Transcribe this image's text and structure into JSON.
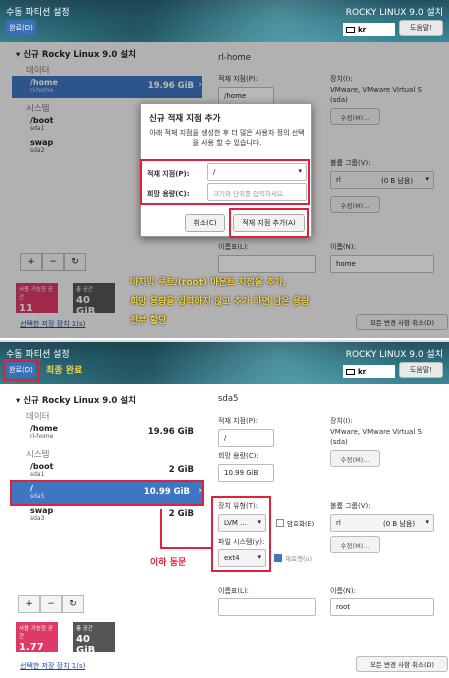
{
  "screen1": {
    "title": "수동 파티션 설정",
    "product": "ROCKY LINUX 9.0 설치",
    "done_label": "완료(D)",
    "keyboard": "kr",
    "help_label": "도움말!",
    "install_group": "신규 Rocky Linux 9.0 설치",
    "category_data": "데이터",
    "category_system": "시스템",
    "partitions": [
      {
        "name": "/home",
        "device": "rl-home",
        "size": "19.96 GiB"
      },
      {
        "name": "/boot",
        "device": "sda1",
        "size": ""
      },
      {
        "name": "swap",
        "device": "sda2",
        "size": ""
      }
    ],
    "selected_name": "rl-home",
    "mount_label": "적재 지점(P):",
    "mount_value": "/home",
    "device_label": "장치(I):",
    "device_value": "VMware, VMware Virtual S",
    "device_value2": "(sda)",
    "modify_label": "수정(M)...",
    "volume_group_label": "볼륨 그룹(V):",
    "volume_group_value": "rl",
    "volume_group_free": "(0 B 남음)",
    "label_label": "이름표(L):",
    "name_label": "이름(N):",
    "name_value": "home",
    "available_label": "사용 가능한 공간",
    "available_value": "11 GiB",
    "total_label": "총 공간",
    "total_value": "40 GiB",
    "storage_link": "선택한 저장 장치 1(s)",
    "reset_label": "모든 변경 사항 취소(D)",
    "dialog": {
      "title": "신규 적재 지점 추가",
      "desc": "아래 적재 지점을 생성한 후 더 많은 사용자 정의 선택을 사용 할 수 있습니다.",
      "mount_label": "적재 지점(P):",
      "mount_value": "/",
      "capacity_label": "희망 용량(C):",
      "capacity_placeholder": "크기와 단위를 입력하세요.",
      "cancel_label": "취소(C)",
      "add_label": "적재 지점 추가(A)"
    },
    "annotation_lines": [
      "마지막 루트/(root) 마운트 지점을 추가,",
      "희망 용량을 입력하지 않고 추가 하면 남은 용량",
      "전부 할당"
    ]
  },
  "screen2": {
    "title": "수동 파티션 설정",
    "product": "ROCKY LINUX 9.0 설치",
    "done_label": "완료(D)",
    "final_note": "최종 완료",
    "keyboard": "kr",
    "help_label": "도움말!",
    "install_group": "신규 Rocky Linux 9.0 설치",
    "category_data": "데이터",
    "category_system": "시스템",
    "partitions": [
      {
        "name": "/home",
        "device": "rl-home",
        "size": "19.96 GiB"
      },
      {
        "name": "/boot",
        "device": "sda1",
        "size": "2 GiB"
      },
      {
        "name": "/",
        "device": "sda5",
        "size": "10.99 GiB"
      },
      {
        "name": "swap",
        "device": "sda3",
        "size": "2 GiB"
      }
    ],
    "selected_name": "sda5",
    "mount_label": "적재 지점(P):",
    "mount_value": "/",
    "capacity_label": "희망 용량(C):",
    "capacity_value": "10.99 GiB",
    "device_label": "장치(I):",
    "device_value": "VMware, VMware Virtual S",
    "device_value2": "(sda)",
    "modify_label": "수정(M)...",
    "device_type_label": "장치 유형(T):",
    "device_type_value": "LVM ...",
    "encrypt_label": "암호화(E)",
    "filesystem_label": "파일 시스템(y):",
    "filesystem_value": "ext4",
    "reformat_label": "재포맷(o)",
    "volume_group_label": "볼륨 그룹(V):",
    "volume_group_value": "rl",
    "volume_group_free": "(0 B 남음)",
    "modify2_label": "수정(M)...",
    "label_label": "이름표(L):",
    "name_label": "이름(N):",
    "name_value": "root",
    "available_label": "사용 가능한 공간",
    "available_value": "1.77 MiB",
    "total_label": "총 공간",
    "total_value": "40 GiB",
    "storage_link": "선택한 저장 장치 1(s)",
    "reset_label": "모든 변경 사항 취소(D)",
    "annotation": "이하 동문"
  }
}
